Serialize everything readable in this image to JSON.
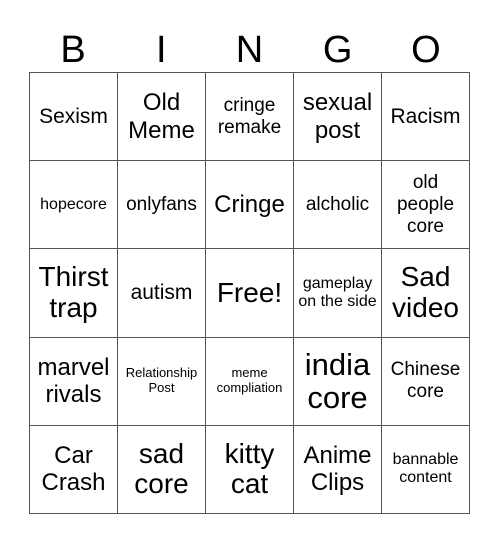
{
  "header": {
    "letters": [
      "B",
      "I",
      "N",
      "G",
      "O"
    ]
  },
  "card": {
    "rows": [
      [
        "Sexism",
        "Old Meme",
        "cringe remake",
        "sexual post",
        "Racism"
      ],
      [
        "hopecore",
        "onlyfans",
        "Cringe",
        "alcholic",
        "old people core"
      ],
      [
        "Thirst trap",
        "autism",
        "Free!",
        "gameplay on the side",
        "Sad video"
      ],
      [
        "marvel rivals",
        "Relationship Post",
        "meme compliation",
        "india core",
        "Chinese core"
      ],
      [
        "Car Crash",
        "sad core",
        "kitty cat",
        "Anime Clips",
        "bannable content"
      ]
    ],
    "free_space": "Free!"
  }
}
